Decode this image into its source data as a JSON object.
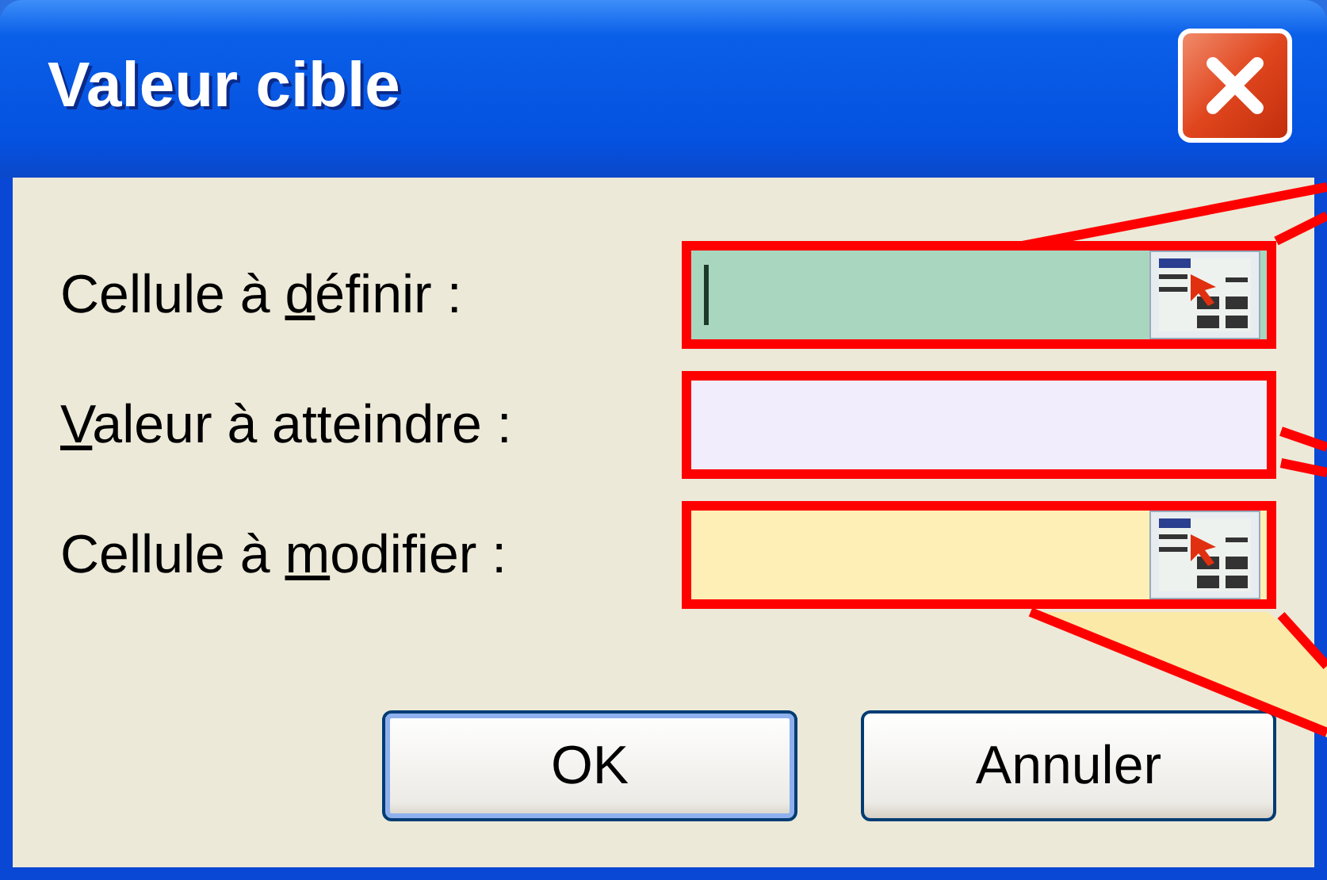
{
  "window": {
    "title": "Valeur cible"
  },
  "fields": [
    {
      "label": {
        "before": "Cellule à ",
        "mnemonic": "d",
        "after": "éfinir :"
      },
      "kind": "reference",
      "color": "#a9d6bf",
      "highlighted": true,
      "focused": true
    },
    {
      "label": {
        "mnemonic": "V",
        "after": "aleur à atteindre :"
      },
      "kind": "value",
      "color": "#f1edfc",
      "highlighted": true,
      "focused": false
    },
    {
      "label": {
        "before": "Cellule à ",
        "mnemonic": "m",
        "after": "odifier :"
      },
      "kind": "reference",
      "color": "#fdefb6",
      "highlighted": true,
      "focused": false
    }
  ],
  "buttons": [
    {
      "label": "OK",
      "default": true
    },
    {
      "label": "Annuler",
      "default": false
    }
  ]
}
